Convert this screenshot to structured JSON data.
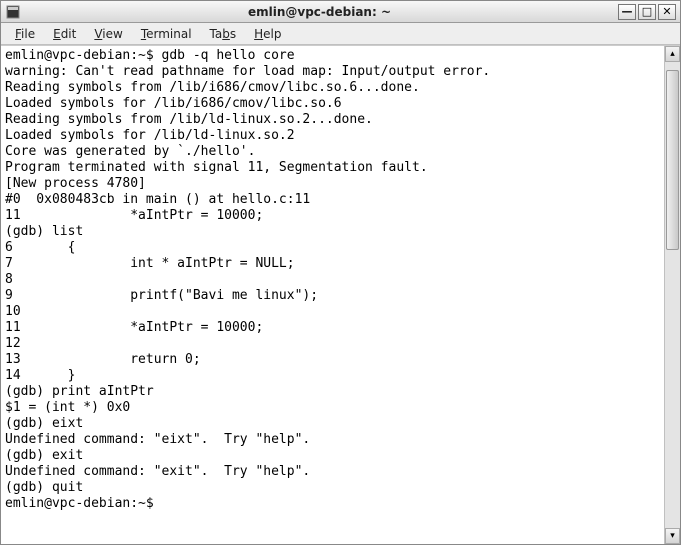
{
  "window": {
    "title": "emlin@vpc-debian: ~"
  },
  "menu": {
    "file": "File",
    "edit": "Edit",
    "view": "View",
    "terminal": "Terminal",
    "tabs": "Tabs",
    "help": "Help"
  },
  "terminal": {
    "lines": [
      "emlin@vpc-debian:~$ gdb -q hello core",
      "warning: Can't read pathname for load map: Input/output error.",
      "Reading symbols from /lib/i686/cmov/libc.so.6...done.",
      "Loaded symbols for /lib/i686/cmov/libc.so.6",
      "Reading symbols from /lib/ld-linux.so.2...done.",
      "Loaded symbols for /lib/ld-linux.so.2",
      "Core was generated by `./hello'.",
      "Program terminated with signal 11, Segmentation fault.",
      "[New process 4780]",
      "#0  0x080483cb in main () at hello.c:11",
      "11              *aIntPtr = 10000;",
      "(gdb) list",
      "6       {",
      "7               int * aIntPtr = NULL;",
      "8",
      "9               printf(\"Bavi me linux\");",
      "10",
      "11              *aIntPtr = 10000;",
      "12",
      "13              return 0;",
      "14      }",
      "(gdb) print aIntPtr",
      "$1 = (int *) 0x0",
      "(gdb) eixt",
      "Undefined command: \"eixt\".  Try \"help\".",
      "(gdb) exit",
      "Undefined command: \"exit\".  Try \"help\".",
      "(gdb) quit",
      "emlin@vpc-debian:~$ "
    ]
  },
  "icons": {
    "app": "▣",
    "minimize": "—",
    "maximize": "□",
    "close": "✕",
    "up": "▴",
    "down": "▾"
  }
}
